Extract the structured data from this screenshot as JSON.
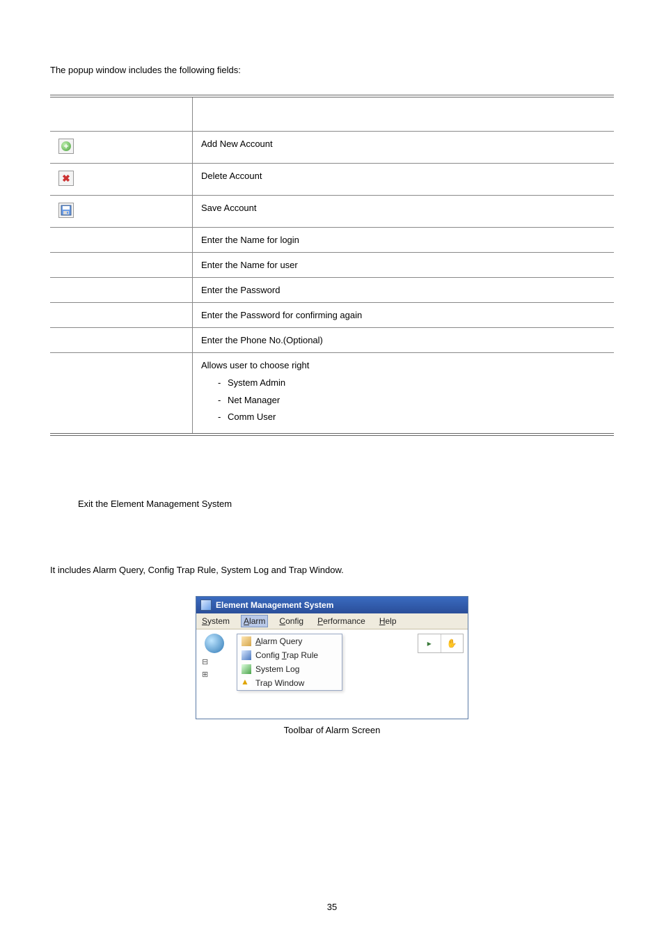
{
  "intro": "The popup window includes the following fields:",
  "rows": {
    "add": "Add New Account",
    "delete": "Delete Account",
    "save": "Save Account",
    "login_name": "Enter the Name for login",
    "user_name": "Enter the Name for user",
    "password": "Enter the Password",
    "confirm_password": "Enter the Password for confirming again",
    "phone": "Enter the Phone No.(Optional)",
    "rights_intro": "Allows user to choose right",
    "rights": {
      "r1": "System Admin",
      "r2": "Net Manager",
      "r3": "Comm User"
    }
  },
  "exit_line": "Exit the Element Management System",
  "alarm_intro": "It includes Alarm Query, Config Trap Rule, System Log and Trap Window.",
  "ems": {
    "title": "Element Management System",
    "menu": {
      "system_pre": "S",
      "system_rest": "ystem",
      "alarm_pre": "A",
      "alarm_rest": "larm",
      "config_pre": "C",
      "config_rest": "onfig",
      "perf_pre": "P",
      "perf_rest": "erformance",
      "help_pre": "H",
      "help_rest": "elp"
    },
    "dropdown": {
      "alarm_query_pre": "A",
      "alarm_query_rest": "larm Query",
      "config_trap_pre1": "Config ",
      "config_trap_u": "T",
      "config_trap_post": "rap Rule",
      "system_log": "System Log",
      "trap_window": "Trap Window"
    },
    "right_tool1": "▸",
    "right_tool2": "✋"
  },
  "figcaption": "Toolbar of Alarm Screen",
  "page_number": "35"
}
